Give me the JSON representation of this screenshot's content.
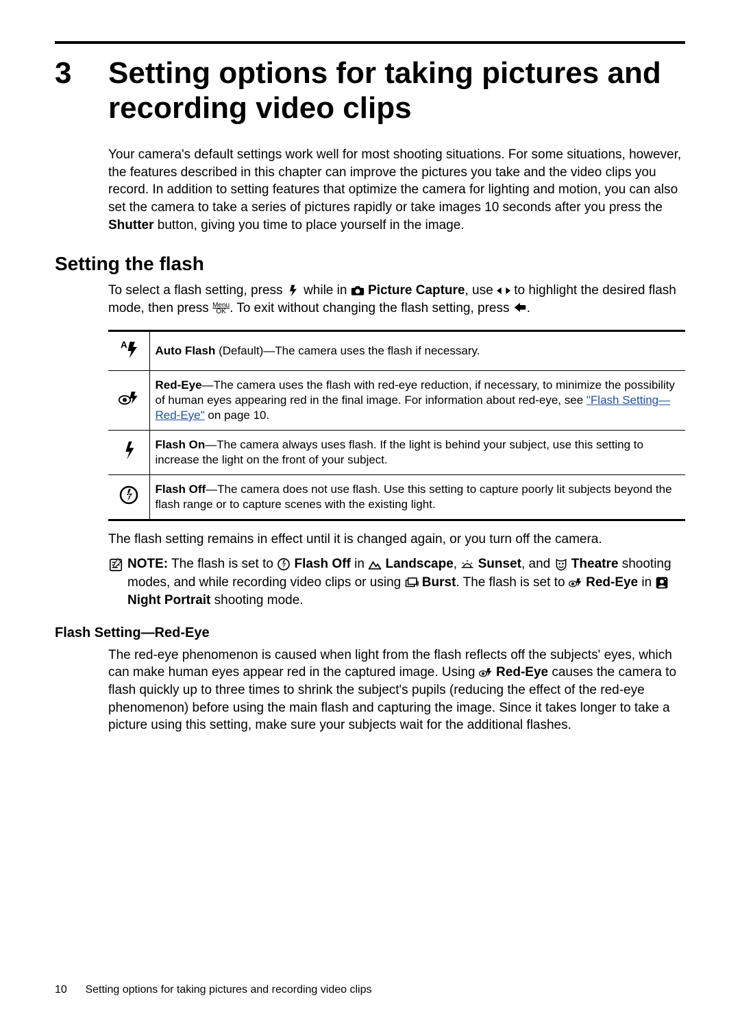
{
  "chapter": {
    "number": "3",
    "title": "Setting options for taking pictures and recording video clips"
  },
  "intro": {
    "pre": "Your camera's default settings work well for most shooting situations. For some situations, however, the features described in this chapter can improve the pictures you take and the video clips you record. In addition to setting features that optimize the camera for lighting and motion, you can also set the camera to take a series of pictures rapidly or take images 10 seconds after you press the ",
    "shutter": "Shutter",
    "post": " button, giving you time to place yourself in the image."
  },
  "section1": {
    "heading": "Setting the flash",
    "p1_a": "To select a flash setting, press ",
    "p1_b": " while in ",
    "picture_capture": "Picture Capture",
    "p1_c": ", use ",
    "p1_d": " to highlight the desired flash mode, then press ",
    "p1_e": ". To exit without changing the flash setting, press ",
    "p1_f": ".",
    "menuok_top": "Menu",
    "menuok_bot": "OK"
  },
  "table": [
    {
      "name": "Auto Flash",
      "desc": " (Default)—The camera uses the flash if necessary."
    },
    {
      "name": "Red-Eye",
      "desc_a": "—The camera uses the flash with red-eye reduction, if necessary, to minimize the possibility of human eyes appearing red in the final image. For information about red-eye, see ",
      "link": "\"Flash Setting—Red-Eye\"",
      "desc_b": " on page 10."
    },
    {
      "name": "Flash On",
      "desc": "—The camera always uses flash. If the light is behind your subject, use this setting to increase the light on the front of your subject."
    },
    {
      "name": "Flash Off",
      "desc": "—The camera does not use flash. Use this setting to capture poorly lit subjects beyond the flash range or to capture scenes with the existing light."
    }
  ],
  "after_table": "The flash setting remains in effect until it is changed again, or you turn off the camera.",
  "note": {
    "label": "NOTE:",
    "a": "  The flash is set to ",
    "flash_off": "Flash Off",
    "b": " in ",
    "landscape": "Landscape",
    "c": ", ",
    "sunset": "Sunset",
    "d": ", and ",
    "theatre": "Theatre",
    "e": " shooting modes, and while recording video clips or using ",
    "burst": "Burst",
    "f": ". The flash is set to ",
    "red_eye": "Red-Eye",
    "g": " in ",
    "night_portrait": "Night Portrait",
    "h": " shooting mode."
  },
  "subsection": {
    "heading": "Flash Setting—Red-Eye",
    "p_a": "The red-eye phenomenon is caused when light from the flash reflects off the subjects' eyes, which can make human eyes appear red in the captured image. Using ",
    "red_eye": "Red-Eye",
    "p_b": " causes the camera to flash quickly up to three times to shrink the subject's pupils (reducing the effect of the red-eye phenomenon) before using the main flash and capturing the image. Since it takes longer to take a picture using this setting, make sure your subjects wait for the additional flashes."
  },
  "footer": {
    "page_num": "10",
    "title": "Setting options for taking pictures and recording video clips"
  }
}
